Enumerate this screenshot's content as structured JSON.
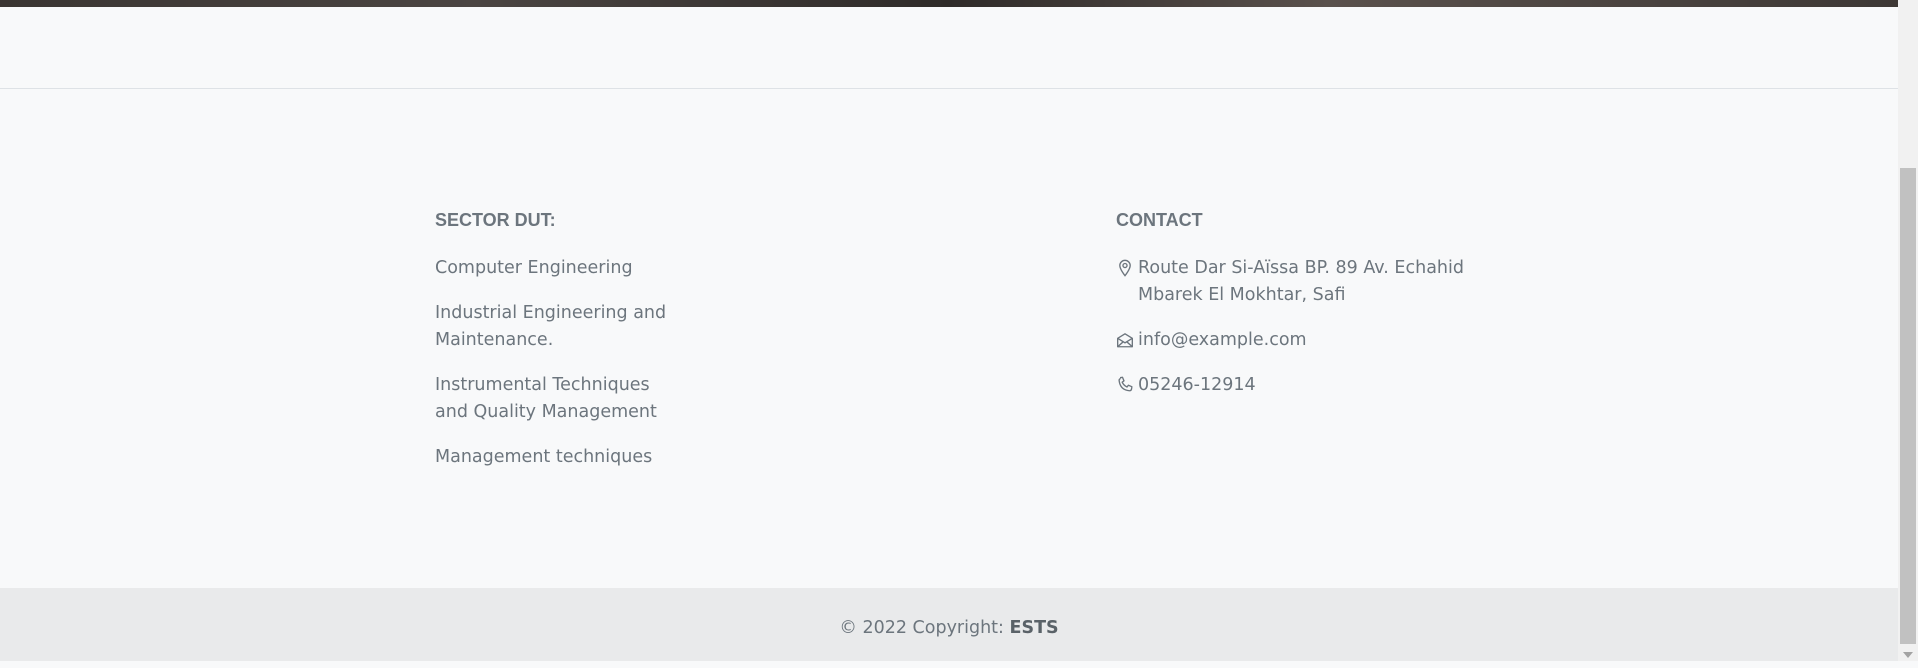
{
  "footer": {
    "sector": {
      "heading": "SECTOR DUT:",
      "links": [
        {
          "label": "Computer Engineering"
        },
        {
          "label": "Industrial Engineering and Maintenance."
        },
        {
          "label": "Instrumental Techniques and Quality Management"
        },
        {
          "label": "Management techniques"
        }
      ]
    },
    "contact": {
      "heading": "CONTACT",
      "address": "Route Dar Si-Aïssa BP. 89 Av. Echahid Mbarek El Mokhtar, Safi",
      "email": "info@example.com",
      "phone": "05246-12914",
      "icons": [
        "location-pin-icon",
        "envelope-icon",
        "phone-icon"
      ]
    }
  },
  "copyright": {
    "prefix": "© 2022 Copyright: ",
    "brand": "ESTS"
  },
  "colors": {
    "background": "#f8f9fa",
    "text": "#6c757d",
    "copyright_bar": "#e9eaeb"
  }
}
